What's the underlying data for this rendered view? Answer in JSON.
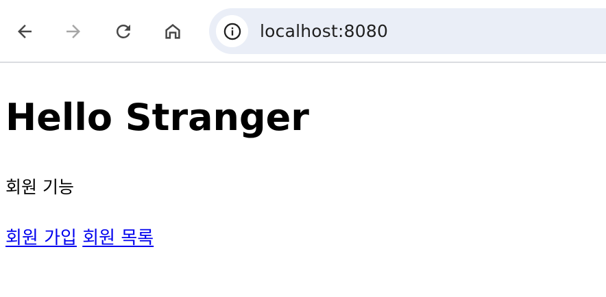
{
  "browser": {
    "url": "localhost:8080",
    "nav_icons": [
      "back-arrow-icon",
      "forward-arrow-icon",
      "reload-icon",
      "home-icon",
      "info-icon"
    ],
    "colors": {
      "icon_active": "#474747",
      "icon_disabled": "#a6a6a6",
      "omnibox_bg": "#eaeef7",
      "link": "#0000ee"
    }
  },
  "page": {
    "title": "Hello Stranger",
    "subtitle": "회원 기능",
    "links": {
      "signup": "회원 가입",
      "list": "회원 목록"
    }
  }
}
